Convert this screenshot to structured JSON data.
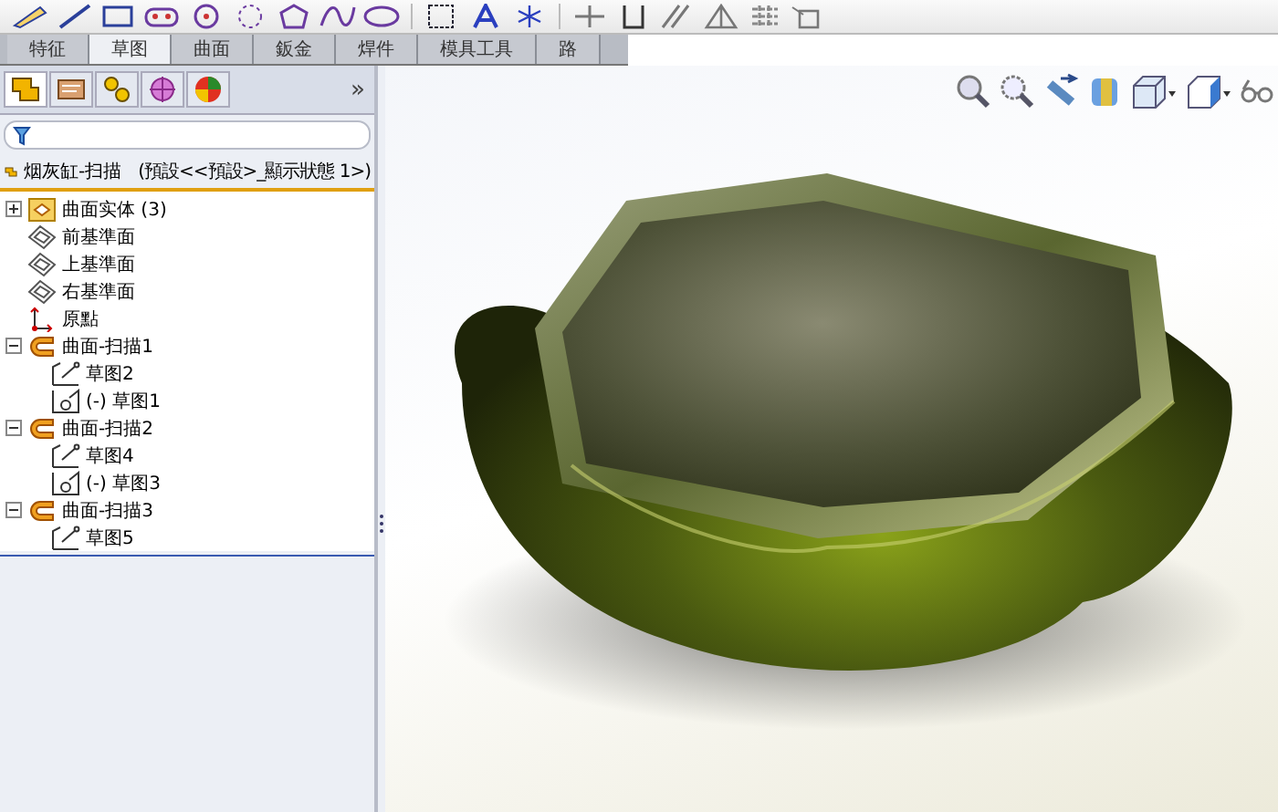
{
  "tabs": [
    {
      "label": "特征",
      "selected": false
    },
    {
      "label": "草图",
      "selected": true
    },
    {
      "label": "曲面",
      "selected": false
    },
    {
      "label": "鈑金",
      "selected": false
    },
    {
      "label": "焊件",
      "selected": false
    },
    {
      "label": "模具工具",
      "selected": false
    },
    {
      "label": "路",
      "selected": false
    }
  ],
  "panel": {
    "more": "»"
  },
  "tree": {
    "root": {
      "label": "烟灰缸-扫描",
      "config": "(預設<<預設>_顯示狀態 1>)"
    },
    "items": [
      {
        "label": "曲面实体 (3)",
        "kind": "folder",
        "expanded": false
      },
      {
        "label": "前基準面",
        "kind": "plane"
      },
      {
        "label": "上基準面",
        "kind": "plane"
      },
      {
        "label": "右基準面",
        "kind": "plane"
      },
      {
        "label": "原點",
        "kind": "origin"
      },
      {
        "label": "曲面-扫描1",
        "kind": "sweep",
        "expanded": true,
        "children": [
          {
            "label": "草图2",
            "kind": "sketch"
          },
          {
            "label": "(-) 草图1",
            "kind": "profile"
          }
        ]
      },
      {
        "label": "曲面-扫描2",
        "kind": "sweep",
        "expanded": true,
        "children": [
          {
            "label": "草图4",
            "kind": "sketch"
          },
          {
            "label": "(-) 草图3",
            "kind": "profile"
          }
        ]
      },
      {
        "label": "曲面-扫描3",
        "kind": "sweep",
        "expanded": true,
        "children": [
          {
            "label": "草图5",
            "kind": "sketch"
          }
        ]
      }
    ]
  }
}
